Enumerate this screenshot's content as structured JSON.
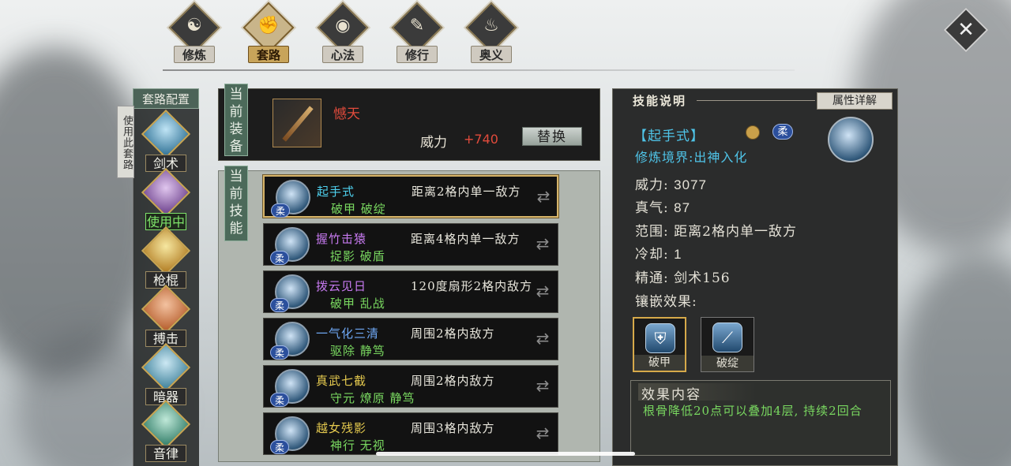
{
  "nav": {
    "tabs": [
      {
        "label": "修炼",
        "glyph": "☯"
      },
      {
        "label": "套路",
        "glyph": "✊"
      },
      {
        "label": "心法",
        "glyph": "◉"
      },
      {
        "label": "修行",
        "glyph": "✎"
      },
      {
        "label": "奥义",
        "glyph": "♨"
      }
    ],
    "active": "套路"
  },
  "sidebar": {
    "title": "套路配置",
    "use_this_set": "使用此套路",
    "weapons": [
      {
        "label": "剑术",
        "status": ""
      },
      {
        "label": "使用中",
        "status": "active"
      },
      {
        "label": "枪棍",
        "status": ""
      },
      {
        "label": "搏击",
        "status": ""
      },
      {
        "label": "暗器",
        "status": ""
      },
      {
        "label": "音律",
        "status": ""
      }
    ]
  },
  "equip": {
    "tag": "当前装备",
    "weapon_name": "憾天",
    "power_label": "威力",
    "power_value": "+740",
    "replace_label": "替换"
  },
  "skills": {
    "tag": "当前技能",
    "badge": "柔",
    "list": [
      {
        "name": "起手式",
        "range": "距离2格内单一敌方",
        "tags": "破甲  破绽",
        "color": "#4fd2f0"
      },
      {
        "name": "握竹击猿",
        "range": "距离4格内单一敌方",
        "tags": "捉影  破盾",
        "color": "#c77af0"
      },
      {
        "name": "拨云见日",
        "range": "120度扇形2格内敌方",
        "tags": "破甲  乱战",
        "color": "#c77af0"
      },
      {
        "name": "一气化三清",
        "range": "周围2格内敌方",
        "tags": "驱除  静笃",
        "color": "#6fa8f5"
      },
      {
        "name": "真武七截",
        "range": "周围2格内敌方",
        "tags": "守元  燎原  静笃",
        "color": "#e3c84e"
      },
      {
        "name": "越女残影",
        "range": "周围3格内敌方",
        "tags": "神行  无视",
        "color": "#e3c84e"
      }
    ]
  },
  "detail": {
    "title": "技能说明",
    "attr_button": "属性详解",
    "skill_name": "【起手式】",
    "badge": "柔",
    "realm": "修炼境界:出神入化",
    "stats": [
      {
        "label": "威力:",
        "value": "3077"
      },
      {
        "label": "真气:",
        "value": "87"
      },
      {
        "label": "范围:",
        "value": "距离2格内单一敌方"
      },
      {
        "label": "冷却:",
        "value": "1"
      },
      {
        "label": "精通:",
        "value": "剑术156"
      }
    ],
    "inlay_label": "镶嵌效果:",
    "inlays": [
      {
        "label": "破甲",
        "icon": "shield-icon",
        "glyph": "⛨"
      },
      {
        "label": "破绽",
        "icon": "blade-icon",
        "glyph": "⟋"
      }
    ],
    "effect_title": "效果内容",
    "effect_text": "根骨降低20点可以叠加4层, 持续2回合"
  }
}
